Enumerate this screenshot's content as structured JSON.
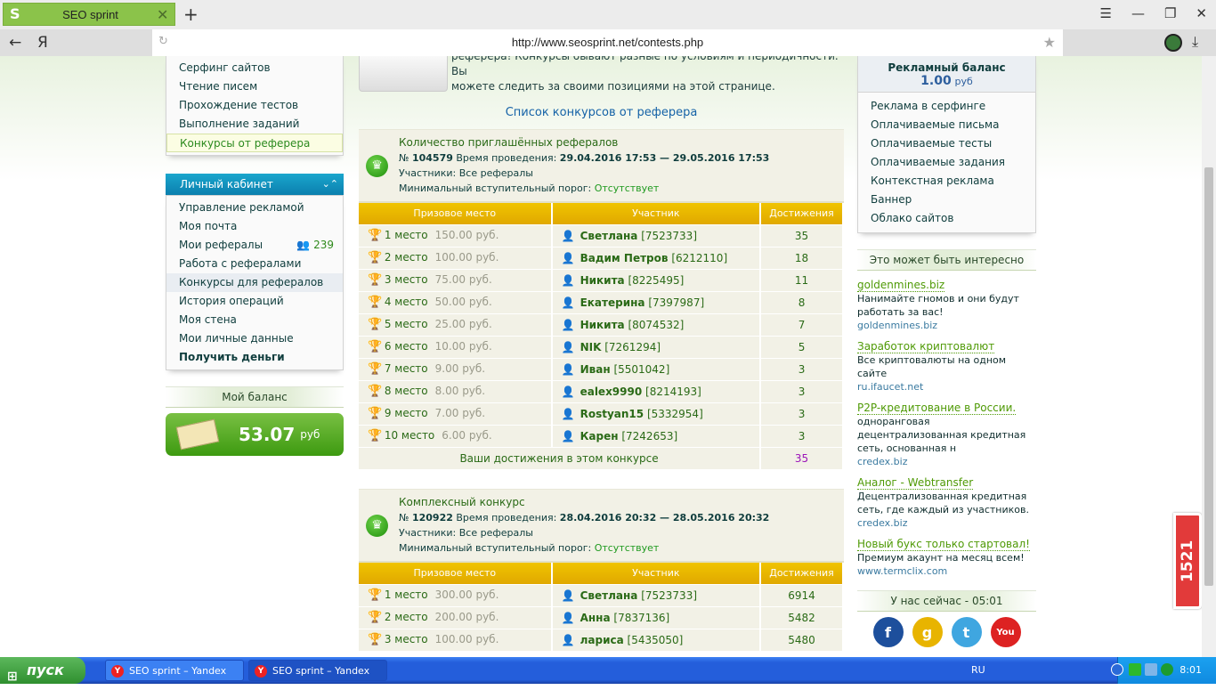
{
  "browser": {
    "tab_title": "SEO sprint",
    "url": "http://www.seosprint.net/contests.php",
    "back": "←",
    "yandex": "Я"
  },
  "left": {
    "work_menu": [
      "Серфинг сайтов",
      "Чтение писем",
      "Прохождение тестов",
      "Выполнение заданий",
      "Конкурсы от реферера"
    ],
    "cabinet_title": "Личный кабинет",
    "cabinet_menu": [
      "Управление рекламой",
      "Моя почта",
      "Мои рефералы",
      "Работа с рефералами",
      "Конкурсы для рефералов",
      "История операций",
      "Моя стена",
      "Мои личные данные",
      "Получить деньги"
    ],
    "referrals_count": "239",
    "balance_title": "Мой баланс",
    "balance_value": "53.07",
    "balance_currency": "руб"
  },
  "main": {
    "intro_lines": [
      "реферера! Конкурсы бывают разные по условиям и периодичности. Вы",
      "можете следить за своими позициями на этой странице."
    ],
    "list_title": "Список конкурсов от реферера",
    "columns": [
      "Призовое место",
      "Участник",
      "Достижения"
    ],
    "contests": [
      {
        "title": "Количество приглашённых рефералов",
        "num_label": "№",
        "number": "104579",
        "time_label": "Время проведения:",
        "period": "29.04.2016 17:53 — 29.05.2016 17:53",
        "participants_label": "Участники:",
        "participants": "Все рефералы",
        "threshold_label": "Минимальный вступительный порог:",
        "threshold": "Отсутствует",
        "rows": [
          {
            "place": "1 место",
            "prize": "150.00 руб.",
            "name": "Светлана",
            "id": "[7523733]",
            "score": "35"
          },
          {
            "place": "2 место",
            "prize": "100.00 руб.",
            "name": "Вадим Петров",
            "id": "[6212110]",
            "score": "18"
          },
          {
            "place": "3 место",
            "prize": "75.00 руб.",
            "name": "Никита",
            "id": "[8225495]",
            "score": "11"
          },
          {
            "place": "4 место",
            "prize": "50.00 руб.",
            "name": "Екатерина",
            "id": "[7397987]",
            "score": "8"
          },
          {
            "place": "5 место",
            "prize": "25.00 руб.",
            "name": "Никита",
            "id": "[8074532]",
            "score": "7"
          },
          {
            "place": "6 место",
            "prize": "10.00 руб.",
            "name": "NIK",
            "id": "[7261294]",
            "score": "5"
          },
          {
            "place": "7 место",
            "prize": "9.00 руб.",
            "name": "Иван",
            "id": "[5501042]",
            "score": "3"
          },
          {
            "place": "8 место",
            "prize": "8.00 руб.",
            "name": "ealex9990",
            "id": "[8214193]",
            "score": "3"
          },
          {
            "place": "9 место",
            "prize": "7.00 руб.",
            "name": "Rostyan15",
            "id": "[5332954]",
            "score": "3"
          },
          {
            "place": "10 место",
            "prize": "6.00 руб.",
            "name": "Карен",
            "id": "[7242653]",
            "score": "3"
          }
        ],
        "your_label": "Ваши достижения в этом конкурсе",
        "your_score": "35"
      },
      {
        "title": "Комплексный конкурс",
        "num_label": "№",
        "number": "120922",
        "time_label": "Время проведения:",
        "period": "28.04.2016 20:32 — 28.05.2016 20:32",
        "participants_label": "Участники:",
        "participants": "Все рефералы",
        "threshold_label": "Минимальный вступительный порог:",
        "threshold": "Отсутствует",
        "rows": [
          {
            "place": "1 место",
            "prize": "300.00 руб.",
            "name": "Светлана",
            "id": "[7523733]",
            "score": "6914"
          },
          {
            "place": "2 место",
            "prize": "200.00 руб.",
            "name": "Анна",
            "id": "[7837136]",
            "score": "5482"
          },
          {
            "place": "3 место",
            "prize": "100.00 руб.",
            "name": "лариса",
            "id": "[5435050]",
            "score": "5480"
          }
        ]
      }
    ]
  },
  "right": {
    "ad_balance_title": "Рекламный баланс",
    "ad_balance_value": "1.00",
    "ad_balance_currency": "руб",
    "ad_menu": [
      "Реклама в серфинге",
      "Оплачиваемые письма",
      "Оплачиваемые тесты",
      "Оплачиваемые задания",
      "Контекстная реклама",
      "Баннер",
      "Облако сайтов"
    ],
    "interesting_title": "Это может быть интересно",
    "ads": [
      {
        "title": "goldenmines.biz",
        "desc": "Нанимайте гномов и они будут работать за вас!",
        "site": "goldenmines.biz"
      },
      {
        "title": "Заработок криптовалют",
        "desc": "Все криптовалюты на одном сайте",
        "site": "ru.ifaucet.net"
      },
      {
        "title": "P2P-кредитование в России.",
        "desc": "одноранговая децентрализованная кредитная сеть, основанная н",
        "site": "credex.biz"
      },
      {
        "title": "Аналог - Webtransfer",
        "desc": "Децентрализованная кредитная сеть, где каждый из участников.",
        "site": "credex.biz"
      },
      {
        "title": "Новый букс только стартовал!",
        "desc": "Премиум акаунт на месяц всем!",
        "site": "www.termclix.com"
      }
    ],
    "time_label": "У нас сейчас - 05:01",
    "social": [
      {
        "name": "facebook",
        "glyph": "f",
        "color": "#1d4f9c"
      },
      {
        "name": "google",
        "glyph": "g",
        "color": "#e8b400"
      },
      {
        "name": "twitter",
        "glyph": "t",
        "color": "#3fa6e0"
      },
      {
        "name": "youtube",
        "glyph": "You",
        "color": "#d22"
      }
    ]
  },
  "widget": "1521",
  "taskbar": {
    "start": "пуск",
    "tasks": [
      "SEO sprint – Yandex",
      "SEO sprint – Yandex"
    ],
    "lang": "RU",
    "clock": "8:01"
  }
}
